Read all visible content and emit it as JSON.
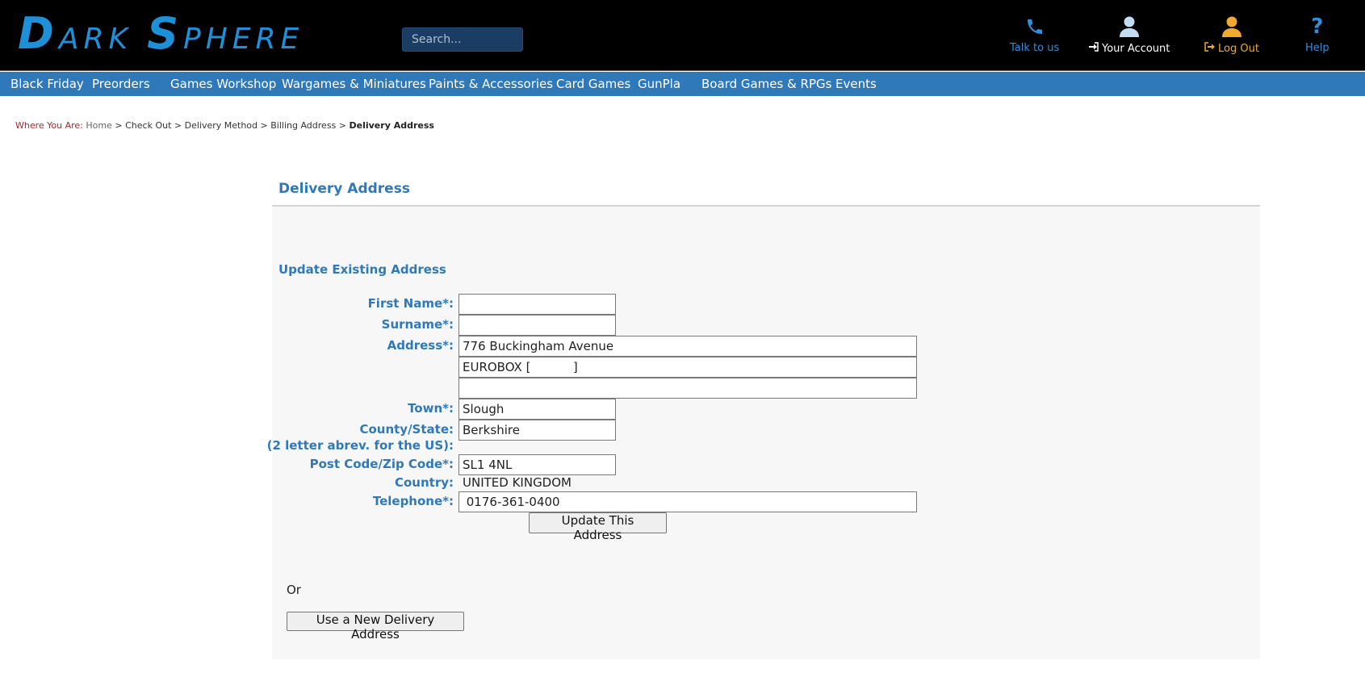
{
  "brand": {
    "logo_big_1": "D",
    "logo_small_1": "ARK",
    "logo_big_2": "S",
    "logo_small_2": "PHERE",
    "color": "#1e90d8"
  },
  "header": {
    "search_placeholder": "Search...",
    "talk_label": "Talk to us",
    "account_label": "Your Account",
    "logout_label": "Log Out",
    "help_label": "Help",
    "accent": "#2f79ba",
    "logout_color": "#f0a830"
  },
  "nav": {
    "items": [
      "Black Friday",
      "Preorders",
      "Games Workshop",
      "Wargames & Miniatures",
      "Paints & Accessories",
      "Card Games",
      "GunPla",
      "Board Games & RPGs",
      "Events"
    ]
  },
  "breadcrumb": {
    "where": "Where You Are:",
    "home": "Home",
    "sep": ">",
    "checkout": "Check Out",
    "delivery_method": "Delivery Method",
    "billing": "Billing Address",
    "current": "Delivery Address"
  },
  "page": {
    "title": "Delivery Address",
    "subtitle": "Update Existing Address",
    "or_text": "Or",
    "new_address_button": "Use a New Delivery Address",
    "update_button": "Update This Address"
  },
  "form": {
    "first_name_label": "First Name*:",
    "first_name_value": "",
    "surname_label": "Surname*:",
    "surname_value": "",
    "address_label": "Address*:",
    "address1_value": "776 Buckingham Avenue",
    "address2_value": "EUROBOX [           ]",
    "address3_value": "",
    "town_label": "Town*:",
    "town_value": "Slough",
    "county_label": "County/State:",
    "county_note": "(2 letter abrev. for the US):",
    "county_value": "Berkshire",
    "postcode_label": "Post Code/Zip Code*:",
    "postcode_value": "SL1 4NL",
    "country_label": "Country:",
    "country_value": "UNITED KINGDOM",
    "telephone_label": "Telephone*:",
    "telephone_value": " 0176-361-0400"
  }
}
